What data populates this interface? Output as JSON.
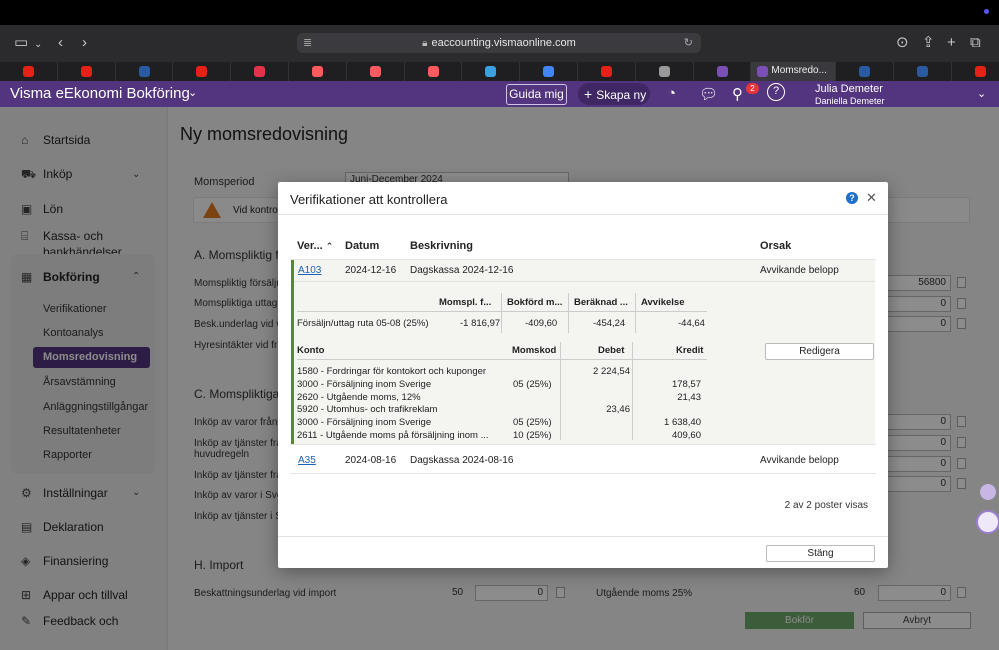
{
  "browser": {
    "url": "eaccounting.vismaonline.com",
    "active_tab_label": "Momsredo...",
    "tabs": [
      {
        "icon": "youtube-icon",
        "color": "#e62117"
      },
      {
        "icon": "youtube-icon",
        "color": "#e62117"
      },
      {
        "icon": "f1-icon",
        "color": "#2a5aa0"
      },
      {
        "icon": "youtube-icon",
        "color": "#e62117"
      },
      {
        "icon": "lips-icon",
        "color": "#e2334a"
      },
      {
        "icon": "airbnb-icon",
        "color": "#ff5a5f"
      },
      {
        "icon": "airbnb-icon",
        "color": "#ff5a5f"
      },
      {
        "icon": "airbnb-icon",
        "color": "#ff5a5f"
      },
      {
        "icon": "plane-icon",
        "color": "#3aa0e0"
      },
      {
        "icon": "google-icon",
        "color": "#4285f4"
      },
      {
        "icon": "youtube-icon",
        "color": "#e62117"
      },
      {
        "icon": "star-icon",
        "color": "#999999"
      },
      {
        "icon": "visma-icon",
        "color": "#7b4fb5"
      }
    ],
    "tabs_after": [
      {
        "icon": "mask-icon",
        "color": "#2a5aa0"
      },
      {
        "icon": "mask-icon",
        "color": "#2a5aa0"
      },
      {
        "icon": "youtube-icon",
        "color": "#e62117"
      }
    ]
  },
  "app": {
    "brand": "Visma eEkonomi Bokföring",
    "guide_label": "Guida mig",
    "new_label": "Skapa ny",
    "notifications_count": "2",
    "user_name": "Julia Demeter",
    "user_company": "Daniella Demeter",
    "accent_color": "#53347e"
  },
  "sidebar": {
    "items": [
      {
        "label": "Startsida",
        "icon": "home-icon"
      },
      {
        "label": "Inköp",
        "icon": "cart-icon"
      },
      {
        "label": "Lön",
        "icon": "wallet-icon"
      },
      {
        "label": "Kassa- och bankhändelser",
        "line1": "Kassa- och",
        "line2": "bankhändelser",
        "icon": "bank-icon"
      },
      {
        "label": "Bokföring",
        "icon": "calculator-icon"
      }
    ],
    "sub_items": [
      "Verifikationer",
      "Kontoanalys",
      "Momsredovisning",
      "Årsavstämning",
      "Anläggningstillgångar",
      "Resultatenheter",
      "Rapporter"
    ],
    "bottom_items": [
      {
        "label": "Inställningar",
        "icon": "gear-icon"
      },
      {
        "label": "Deklaration",
        "icon": "document-icon"
      },
      {
        "label": "Finansiering",
        "icon": "finance-icon"
      },
      {
        "label": "Appar och tillval",
        "icon": "apps-icon"
      },
      {
        "label": "Feedback och",
        "icon": "feedback-icon"
      }
    ]
  },
  "main": {
    "title": "Ny momsredovisning",
    "period_label": "Momsperiod",
    "period_value": "Juni-December 2024",
    "warning_text": "Vid kontrol",
    "section_a": "A. Momspliktig f",
    "a_rows": [
      "Momspliktig försäljn",
      "Momspliktiga uttag",
      "Besk.underlag vid vi",
      "Hyresintäkter vid fri"
    ],
    "a_values": [
      "56800",
      "0",
      "0"
    ],
    "section_c": "C. Momspliktiga",
    "c_rows": [
      "Inköp av varor från a",
      "Inköp av tjänster frå",
      "huvudregeln",
      "Inköp av tjänster frå",
      "Inköp av varor i Sver",
      "Inköp av tjänster i Sv"
    ],
    "c_values": [
      "0",
      "0",
      "0",
      "0"
    ],
    "section_h": "H. Import",
    "import_label": "Beskattningsunderlag vid import",
    "import_code": "50",
    "import_value": "0",
    "out_label": "Utgående moms 25%",
    "out_code": "60",
    "out_value": "0",
    "book_label": "Bokför",
    "cancel_label": "Avbryt"
  },
  "modal": {
    "title": "Verifikationer att kontrollera",
    "help": "?",
    "columns": {
      "ver": "Ver...",
      "date": "Datum",
      "desc": "Beskrivning",
      "reason": "Orsak"
    },
    "rows": [
      {
        "ver": "A103",
        "date": "2024-12-16",
        "desc": "Dagskassa 2024-12-16",
        "reason": "Avvikande belopp"
      },
      {
        "ver": "A35",
        "date": "2024-08-16",
        "desc": "Dagskassa 2024-08-16",
        "reason": "Avvikande belopp"
      }
    ],
    "detail": {
      "summary_headers": [
        "Momspl. f...",
        "Bokförd m...",
        "Beräknad ...",
        "Avvikelse"
      ],
      "summary_row": {
        "label": "Försäljn/uttag ruta 05-08 (25%)",
        "values": [
          "-1 816,97",
          "-409,60",
          "-454,24",
          "-44,64"
        ]
      },
      "edit_label": "Redigera",
      "account_headers": {
        "account": "Konto",
        "vat": "Momskod",
        "debit": "Debet",
        "credit": "Kredit"
      },
      "accounts": [
        {
          "account": "1580 - Fordringar för kontokort och kuponger",
          "vat": "",
          "debit": "2 224,54",
          "credit": ""
        },
        {
          "account": "3000 - Försäljning inom Sverige",
          "vat": "05 (25%)",
          "debit": "",
          "credit": "178,57"
        },
        {
          "account": "2620 - Utgående moms, 12%",
          "vat": "",
          "debit": "",
          "credit": "21,43"
        },
        {
          "account": "5920 - Utomhus- och trafikreklam",
          "vat": "",
          "debit": "23,46",
          "credit": ""
        },
        {
          "account": "3000 - Försäljning inom Sverige",
          "vat": "05 (25%)",
          "debit": "",
          "credit": "1 638,40"
        },
        {
          "account": "2611 - Utgående moms på försäljning inom ...",
          "vat": "10 (25%)",
          "debit": "",
          "credit": "409,60"
        }
      ]
    },
    "count_text": "2 av 2 poster visas",
    "close_label": "Stäng"
  }
}
